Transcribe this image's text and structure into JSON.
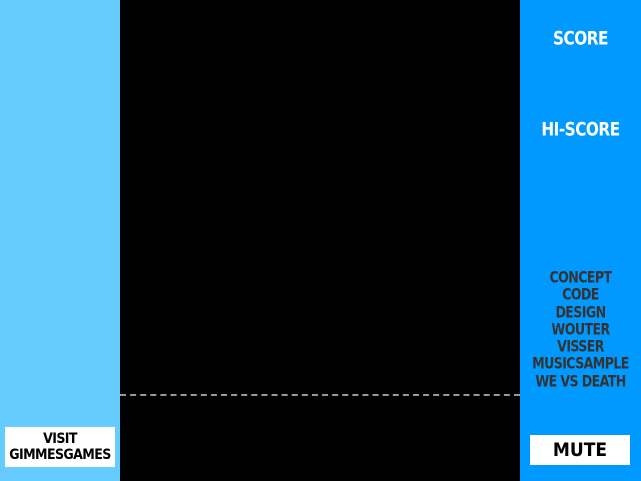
{
  "left_panel": {
    "visit_line1": "VISIT",
    "visit_line2": "GIMMESGAMES"
  },
  "right_panel": {
    "score_label": "SCORE",
    "score_value": "",
    "hiscore_label": "HI-SCORE",
    "hiscore_value": "",
    "credits": [
      "CONCEPT",
      "CODE",
      "DESIGN",
      "WOUTER",
      "VISSER",
      "MUSICSAMPLE",
      "WE VS DEATH"
    ],
    "mute_label": "MUTE"
  },
  "colors": {
    "left_panel": "#66ccff",
    "right_panel": "#0099ff",
    "play_area": "#000000"
  }
}
